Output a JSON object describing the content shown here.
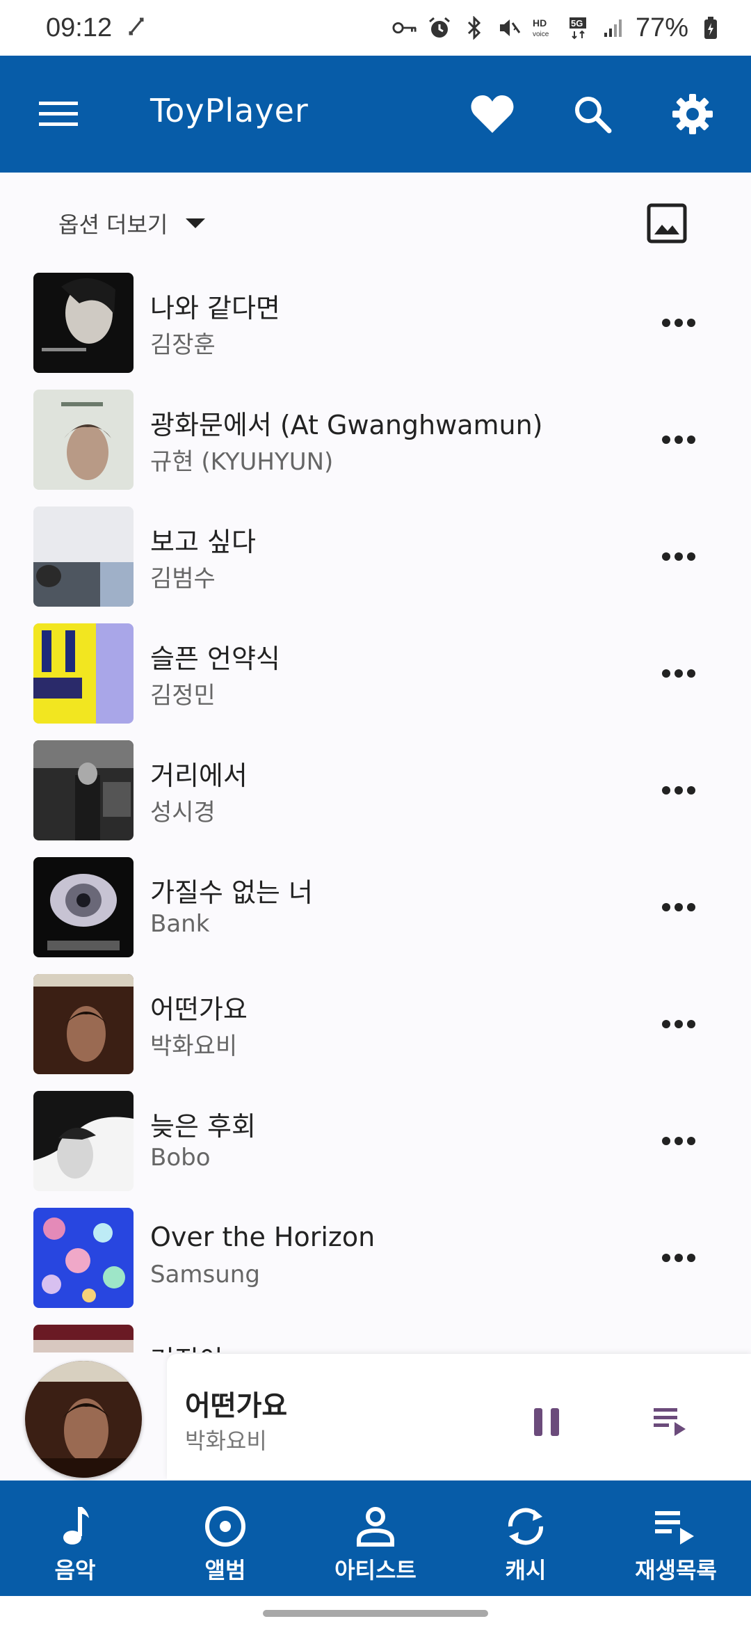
{
  "status_bar": {
    "time": "09:12",
    "battery": "77%",
    "icons": [
      "sync-icon",
      "vpn-key-icon",
      "alarm-icon",
      "bluetooth-icon",
      "vibrate-icon",
      "hd-voice-icon",
      "5g-icon",
      "signal-icon",
      "battery-icon"
    ]
  },
  "app_bar": {
    "title": "ToyPlayer",
    "background": "#075ca8",
    "icons": [
      "menu-icon",
      "heart-icon",
      "search-icon",
      "settings-icon"
    ]
  },
  "options": {
    "label": "옵션 더보기",
    "image_icon": "image-icon"
  },
  "songs": [
    {
      "title": "나와 같다면",
      "artist": "김장훈"
    },
    {
      "title": "광화문에서 (At Gwanghwamun)",
      "artist": "규현 (KYUHYUN)"
    },
    {
      "title": "보고 싶다",
      "artist": "김범수"
    },
    {
      "title": "슬픈 언약식",
      "artist": "김정민"
    },
    {
      "title": "거리에서",
      "artist": "성시경"
    },
    {
      "title": "가질수 없는 너",
      "artist": "Bank"
    },
    {
      "title": "어떤가요",
      "artist": "박화요비"
    },
    {
      "title": "늦은 후회",
      "artist": "Bobo"
    },
    {
      "title": "Over the Horizon",
      "artist": "Samsung"
    },
    {
      "title": "거짓이",
      "artist": ""
    }
  ],
  "mini_player": {
    "title": "어떤가요",
    "artist": "박화요비",
    "state": "playing"
  },
  "bottom_nav": [
    {
      "label": "음악",
      "icon": "music-note-icon"
    },
    {
      "label": "앨범",
      "icon": "album-icon"
    },
    {
      "label": "아티스트",
      "icon": "person-icon"
    },
    {
      "label": "캐시",
      "icon": "sync-icon"
    },
    {
      "label": "재생목록",
      "icon": "playlist-icon"
    }
  ]
}
